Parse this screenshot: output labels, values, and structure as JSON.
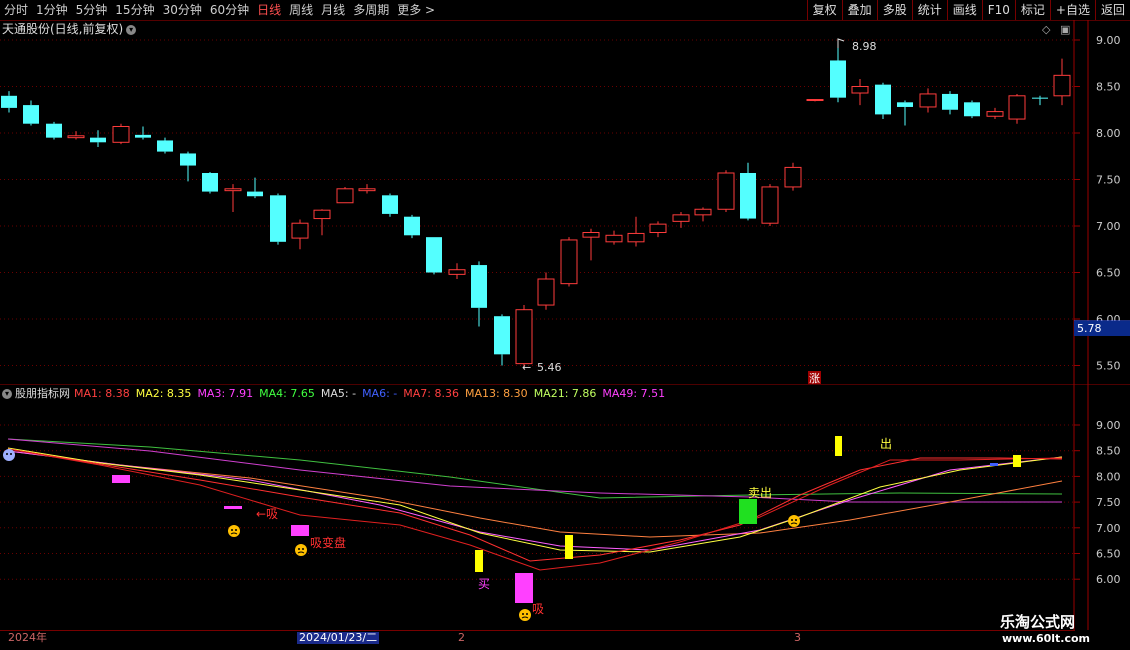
{
  "toolbar": {
    "tabs": [
      "分时",
      "1分钟",
      "5分钟",
      "15分钟",
      "30分钟",
      "60分钟",
      "日线",
      "周线",
      "月线",
      "多周期",
      "更多 >"
    ],
    "active_tab": "日线",
    "right_buttons": [
      "复权",
      "叠加",
      "多股",
      "统计",
      "画线",
      "F10",
      "标记",
      "+自选",
      "返回"
    ]
  },
  "main_chart": {
    "title": "天通股份(日线,前复权)",
    "price_axis": [
      "9.00",
      "8.50",
      "8.00",
      "7.50",
      "7.00",
      "6.50",
      "6.00",
      "5.50"
    ],
    "current_price": "5.78",
    "high_marker": "8.98",
    "low_marker": "5.46",
    "badge": "涨"
  },
  "indicator": {
    "name": "股朋指标网",
    "mas": [
      {
        "label": "MA1: 8.38",
        "color": "#ff4040"
      },
      {
        "label": "MA2: 8.35",
        "color": "#ffff40"
      },
      {
        "label": "MA3: 7.91",
        "color": "#ff40ff"
      },
      {
        "label": "MA4: 7.65",
        "color": "#40ff40"
      },
      {
        "label": "MA5: -",
        "color": "#dddddd"
      },
      {
        "label": "MA6: -",
        "color": "#4060ff"
      },
      {
        "label": "MA7: 8.36",
        "color": "#ff4040"
      },
      {
        "label": "MA13: 8.30",
        "color": "#ffa040"
      },
      {
        "label": "MA21: 7.86",
        "color": "#c0ff60"
      },
      {
        "label": "MA49: 7.51",
        "color": "#ff40ff"
      }
    ],
    "axis": [
      "9.00",
      "8.50",
      "8.00",
      "7.50",
      "7.00",
      "6.50",
      "6.00"
    ],
    "annotations": {
      "xi1": "吸",
      "xi2": "吸变盘",
      "buy": "买",
      "xi3": "吸",
      "sell1": "卖出",
      "sell2": "出"
    }
  },
  "date_bar": {
    "year": "2024年",
    "selected": "2024/01/23/二",
    "m2": "2",
    "m3": "3"
  },
  "watermark": {
    "line1": "乐淘公式网",
    "line2": "www.60lt.com"
  },
  "colors": {
    "up": "#ff3c3c",
    "down": "#54ffff",
    "grid": "#7a0000",
    "background": "#000000"
  }
}
